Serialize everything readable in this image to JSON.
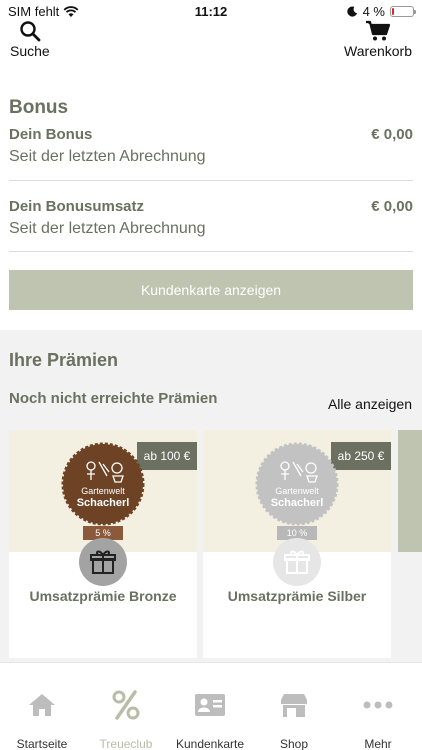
{
  "status_bar": {
    "carrier": "SIM fehlt",
    "time": "11:12",
    "battery": "4 %",
    "battery_level": 0.04
  },
  "header": {
    "search_label": "Suche",
    "cart_label": "Warenkorb"
  },
  "bonus": {
    "title": "Bonus",
    "rows": [
      {
        "label": "Dein Bonus",
        "value": "€ 0,00",
        "sub": "Seit der letzten Abrechnung"
      },
      {
        "label": "Dein Bonusumsatz",
        "value": "€ 0,00",
        "sub": "Seit der letzten Abrechnung"
      }
    ],
    "card_button": "Kundenkarte anzeigen"
  },
  "rewards": {
    "title": "Ihre Prämien",
    "pending_title": "Noch nicht erreichte Prämien",
    "show_all": "Alle anzeigen",
    "cards": [
      {
        "price": "ab 100 €",
        "name": "Umsatzprämie Bronze",
        "badge_line1": "Gartenwelt",
        "badge_line2": "Schacherl",
        "percent": "5 %",
        "badge_color": "#6e4225",
        "pct_color": "#8a5a3a"
      },
      {
        "price": "ab 250 €",
        "name": "Umsatzprämie Silber",
        "badge_line1": "Gartenwelt",
        "badge_line2": "Schacherl",
        "percent": "10 %",
        "badge_color": "#c2c2c2",
        "pct_color": "#b8b8b8"
      }
    ]
  },
  "tabs": [
    {
      "label": "Startseite",
      "icon": "home-icon"
    },
    {
      "label": "Treueclub",
      "icon": "percent-icon",
      "active": true
    },
    {
      "label": "Kundenkarte",
      "icon": "id-card-icon"
    },
    {
      "label": "Shop",
      "icon": "store-icon"
    },
    {
      "label": "Mehr",
      "icon": "more-icon"
    }
  ]
}
